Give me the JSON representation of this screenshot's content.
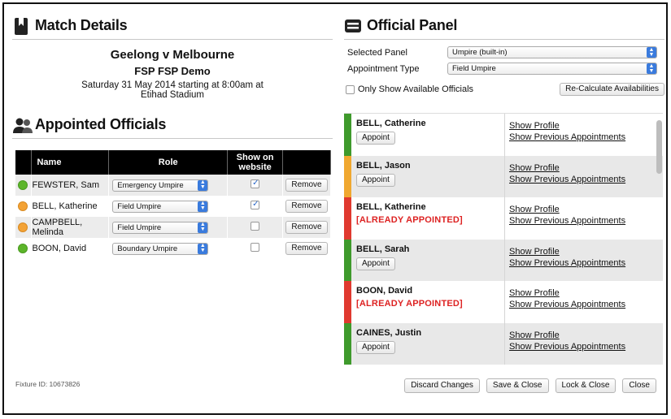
{
  "match_details": {
    "title": "Match Details",
    "match_name": "Geelong v Melbourne",
    "competition": "FSP FSP Demo",
    "date_line": "Saturday 31 May 2014 starting at 8:00am at",
    "venue": "Etihad Stadium"
  },
  "appointed_officials": {
    "title": "Appointed Officials",
    "columns": {
      "name": "Name",
      "role": "Role",
      "show_on_website": "Show on website"
    },
    "rows": [
      {
        "status_color": "green",
        "name": "FEWSTER, Sam",
        "role": "Emergency Umpire",
        "show": true,
        "remove_label": "Remove"
      },
      {
        "status_color": "orange",
        "name": "BELL, Katherine",
        "role": "Field Umpire",
        "show": true,
        "remove_label": "Remove"
      },
      {
        "status_color": "orange",
        "name": "CAMPBELL, Melinda",
        "role": "Field Umpire",
        "show": false,
        "remove_label": "Remove"
      },
      {
        "status_color": "green",
        "name": "BOON, David",
        "role": "Boundary Umpire",
        "show": false,
        "remove_label": "Remove"
      }
    ]
  },
  "fixture_id": "Fixture ID: 10673826",
  "official_panel": {
    "title": "Official Panel",
    "selected_panel_label": "Selected Panel",
    "selected_panel_value": "Umpire (built-in)",
    "appointment_type_label": "Appointment Type",
    "appointment_type_value": "Field Umpire",
    "only_available_label": "Only Show Available Officials",
    "only_available_checked": false,
    "recalculate_label": "Re-Calculate Availabilities",
    "officials": [
      {
        "name": "BELL, Catherine",
        "status_color": "#3f9a2c",
        "appointed": false,
        "appoint_label": "Appoint",
        "profile_label": "Show Profile",
        "previous_label": "Show Previous Appointments"
      },
      {
        "name": "BELL, Jason",
        "status_color": "#f0a830",
        "appointed": false,
        "appoint_label": "Appoint",
        "profile_label": "Show Profile",
        "previous_label": "Show Previous Appointments"
      },
      {
        "name": "BELL, Katherine",
        "status_color": "#e0392f",
        "appointed": true,
        "appointed_label": "[ALREADY APPOINTED]",
        "profile_label": "Show Profile",
        "previous_label": "Show Previous Appointments"
      },
      {
        "name": "BELL, Sarah",
        "status_color": "#3f9a2c",
        "appointed": false,
        "appoint_label": "Appoint",
        "profile_label": "Show Profile",
        "previous_label": "Show Previous Appointments"
      },
      {
        "name": "BOON, David",
        "status_color": "#e0392f",
        "appointed": true,
        "appointed_label": "[ALREADY APPOINTED]",
        "profile_label": "Show Profile",
        "previous_label": "Show Previous Appointments"
      },
      {
        "name": "CAINES, Justin",
        "status_color": "#3f9a2c",
        "appointed": false,
        "appoint_label": "Appoint",
        "profile_label": "Show Profile",
        "previous_label": "Show Previous Appointments"
      }
    ]
  },
  "footer": {
    "discard_label": "Discard Changes",
    "save_close_label": "Save & Close",
    "lock_close_label": "Lock & Close",
    "close_label": "Close"
  },
  "colors": {
    "accent_blue": "#3a7bdd",
    "status_green": "#5cb52a",
    "status_orange": "#f3a235",
    "status_red": "#e0392f",
    "appointed_text": "#dd2222"
  }
}
